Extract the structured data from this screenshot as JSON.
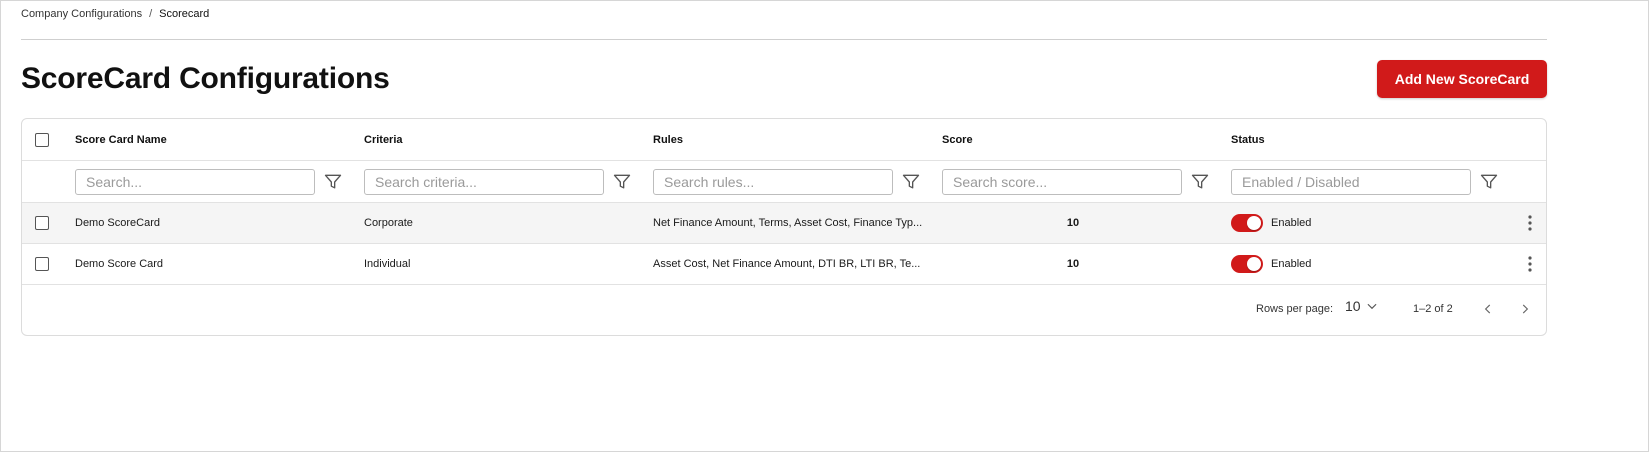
{
  "breadcrumb": {
    "parent": "Company Configurations",
    "separator": "/",
    "current": "Scorecard"
  },
  "page": {
    "title": "ScoreCard Configurations",
    "add_button_label": "Add New ScoreCard"
  },
  "table": {
    "columns": [
      "Score Card Name",
      "Criteria",
      "Rules",
      "Score",
      "Status"
    ],
    "filters": [
      {
        "placeholder": "Search..."
      },
      {
        "placeholder": "Search criteria..."
      },
      {
        "placeholder": "Search rules..."
      },
      {
        "placeholder": "Search score..."
      },
      {
        "placeholder": "Enabled / Disabled"
      }
    ],
    "rows": [
      {
        "name": "Demo ScoreCard",
        "criteria": "Corporate",
        "rules": "Net Finance Amount, Terms, Asset Cost, Finance Typ...",
        "score": "10",
        "status": "Enabled",
        "enabled": true
      },
      {
        "name": "Demo Score Card",
        "criteria": "Individual",
        "rules": "Asset Cost, Net Finance Amount, DTI BR, LTI BR, Te...",
        "score": "10",
        "status": "Enabled",
        "enabled": true
      }
    ]
  },
  "pagination": {
    "rows_per_page_label": "Rows per page:",
    "rows_per_page_value": "10",
    "range": "1–2 of 2"
  },
  "colors": {
    "accent": "#d11a1a",
    "row_alt": "#f5f5f5",
    "border": "#dcdcdc"
  },
  "icons": {
    "filter": "filter-icon",
    "kebab": "more-vertical-icon",
    "chevron_down": "chevron-down-icon",
    "prev": "chevron-left-icon",
    "next": "chevron-right-icon"
  }
}
